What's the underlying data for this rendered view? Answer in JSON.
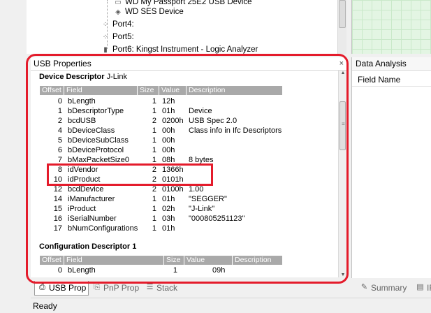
{
  "tree": {
    "items": [
      {
        "label": "WD My Passport 25E2 USB Device",
        "icon": "drive-icon"
      },
      {
        "label": "WD SES Device",
        "icon": "device-icon"
      },
      {
        "label": "Port4:",
        "icon": "port-icon"
      },
      {
        "label": "Port5:",
        "icon": "port-icon"
      },
      {
        "label": "Port6: Kingst Instrument - Logic Analyzer",
        "icon": "usb-plug-icon"
      }
    ]
  },
  "usb_properties": {
    "title": "USB Properties",
    "close": "×",
    "device_descriptor": {
      "title": "Device Descriptor",
      "subtitle": "J-Link",
      "headers": [
        "Offset",
        "Field",
        "Size",
        "Value",
        "Description"
      ],
      "rows": [
        {
          "offset": "0",
          "field": "bLength",
          "size": "1",
          "value": "12h",
          "desc": ""
        },
        {
          "offset": "1",
          "field": "bDescriptorType",
          "size": "1",
          "value": "01h",
          "desc": "Device"
        },
        {
          "offset": "2",
          "field": "bcdUSB",
          "size": "2",
          "value": "0200h",
          "desc": "USB Spec 2.0"
        },
        {
          "offset": "4",
          "field": "bDeviceClass",
          "size": "1",
          "value": "00h",
          "desc": "Class info in Ifc Descriptors"
        },
        {
          "offset": "5",
          "field": "bDeviceSubClass",
          "size": "1",
          "value": "00h",
          "desc": ""
        },
        {
          "offset": "6",
          "field": "bDeviceProtocol",
          "size": "1",
          "value": "00h",
          "desc": ""
        },
        {
          "offset": "7",
          "field": "bMaxPacketSize0",
          "size": "1",
          "value": "08h",
          "desc": "8 bytes"
        },
        {
          "offset": "8",
          "field": "idVendor",
          "size": "2",
          "value": "1366h",
          "desc": ""
        },
        {
          "offset": "10",
          "field": "idProduct",
          "size": "2",
          "value": "0101h",
          "desc": ""
        },
        {
          "offset": "12",
          "field": "bcdDevice",
          "size": "2",
          "value": "0100h",
          "desc": "1.00"
        },
        {
          "offset": "14",
          "field": "iManufacturer",
          "size": "1",
          "value": "01h",
          "desc": "\"SEGGER\""
        },
        {
          "offset": "15",
          "field": "iProduct",
          "size": "1",
          "value": "02h",
          "desc": "\"J-Link\""
        },
        {
          "offset": "16",
          "field": "iSerialNumber",
          "size": "1",
          "value": "03h",
          "desc": "\"000805251123\""
        },
        {
          "offset": "17",
          "field": "bNumConfigurations",
          "size": "1",
          "value": "01h",
          "desc": ""
        }
      ]
    },
    "configuration_descriptor": {
      "title": "Configuration Descriptor 1",
      "headers": [
        "Offset",
        "Field",
        "Size",
        "Value",
        "Description"
      ],
      "rows": [
        {
          "offset": "0",
          "field": "bLength",
          "size": "1",
          "value": "09h",
          "desc": ""
        }
      ]
    }
  },
  "data_analysis": {
    "title": "Data Analysis",
    "column": "Field Name"
  },
  "tabs_left": [
    {
      "label": "USB Prop",
      "icon": "usb-prop-icon",
      "active": true
    },
    {
      "label": "PnP Prop",
      "icon": "pnp-prop-icon",
      "active": false
    },
    {
      "label": "Stack",
      "icon": "stack-icon",
      "active": false
    }
  ],
  "tabs_right": [
    {
      "label": "Summary",
      "icon": "summary-icon",
      "active": false
    },
    {
      "label": "IR",
      "icon": "ir-icon",
      "active": false
    }
  ],
  "status": "Ready",
  "colors": {
    "highlight": "#e41b2b",
    "header_bg": "#a9a9a9",
    "grid": "#e3f5e3"
  }
}
